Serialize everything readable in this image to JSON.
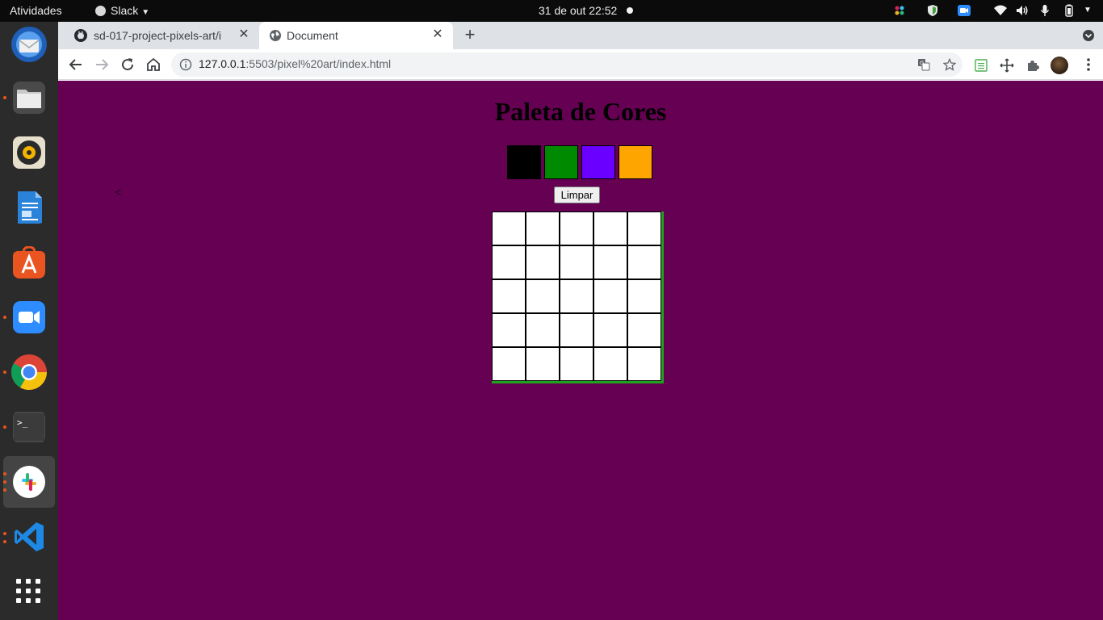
{
  "topbar": {
    "activities": "Atividades",
    "app_menu": "Slack",
    "clock": "31 de out  22:52"
  },
  "dock": {
    "apps": [
      {
        "name": "thunderbird-icon",
        "color": "#2a6fcf"
      },
      {
        "name": "files-icon",
        "color": "#c9c9c9"
      },
      {
        "name": "rhythmbox-icon",
        "color": "#e8e1cf"
      },
      {
        "name": "libreoffice-writer-icon",
        "color": "#2c7fd6"
      },
      {
        "name": "software-center-icon",
        "color": "#e95420"
      },
      {
        "name": "zoom-icon",
        "color": "#2d8cff"
      },
      {
        "name": "chrome-icon",
        "color": "#dd4b39"
      },
      {
        "name": "terminal-icon",
        "color": "#3a3a3a"
      },
      {
        "name": "slack-icon",
        "color": "#ffffff"
      },
      {
        "name": "vscode-icon",
        "color": "#1e88e5"
      }
    ]
  },
  "browser": {
    "tabs": [
      {
        "title": "sd-017-project-pixels-art/i",
        "active": false
      },
      {
        "title": "Document",
        "active": true
      }
    ],
    "url_host": "127.0.0.1",
    "url_path": ":5503/pixel%20art/index.html"
  },
  "page": {
    "background": "#660053",
    "title": "Paleta de Cores",
    "palette": [
      "#000000",
      "#008a00",
      "#6a00ff",
      "#ffa500"
    ],
    "stray_text": "<",
    "clear_button": "Limpar",
    "board_border_color": "#1fa31f",
    "pixel_color": "#ffffff",
    "board_rows": 5,
    "board_cols": 5
  }
}
